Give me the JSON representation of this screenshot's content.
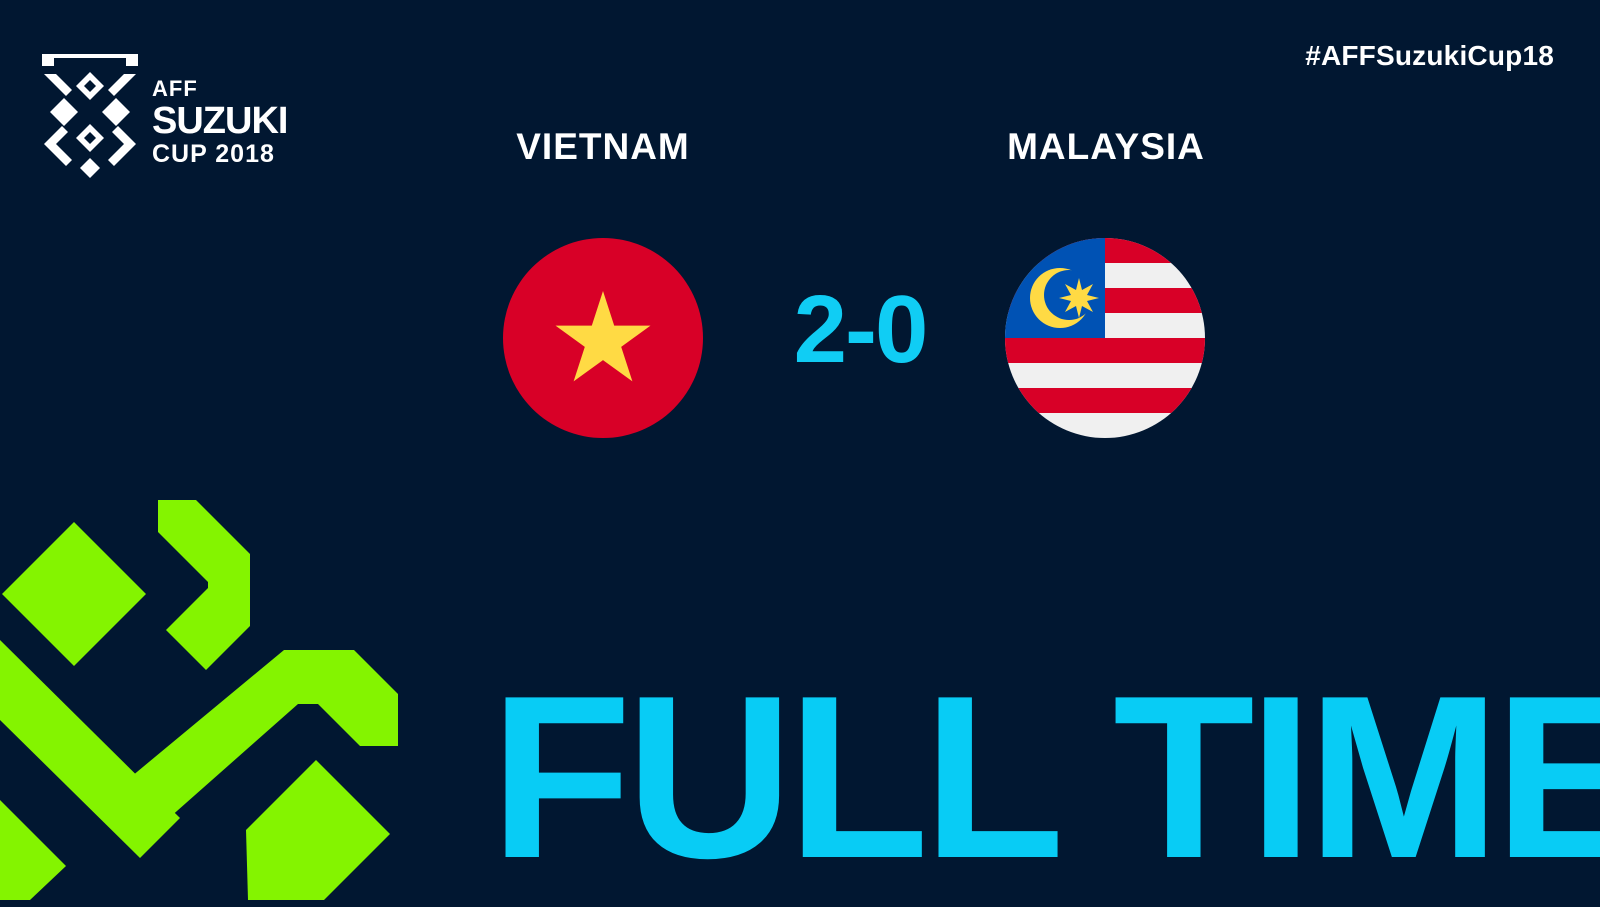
{
  "logo": {
    "line1": "AFF",
    "line2": "SUZUKI",
    "line3": "CUP 2018"
  },
  "hashtag": "#AFFSuzukiCup18",
  "match": {
    "home_team": "VIETNAM",
    "away_team": "MALAYSIA",
    "score": "2-0",
    "status": "FULL TIME"
  },
  "colors": {
    "background": "#011731",
    "accent_cyan": "#08ccf5",
    "accent_green": "#84f400"
  }
}
